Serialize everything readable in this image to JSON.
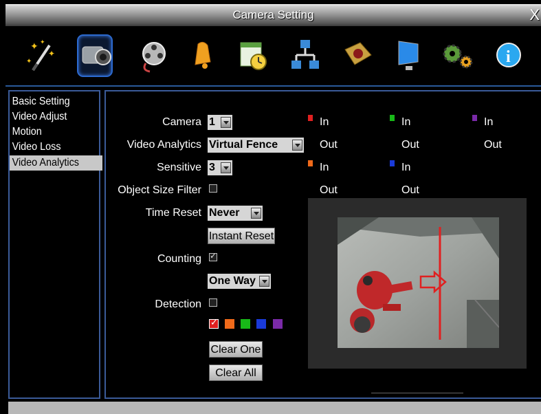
{
  "window": {
    "title": "Camera Setting",
    "close_glyph": "X"
  },
  "toolbar": {
    "icons": [
      {
        "name": "wizard-wand-icon"
      },
      {
        "name": "camera-icon",
        "selected": true
      },
      {
        "name": "video-reel-icon"
      },
      {
        "name": "alarm-bell-icon"
      },
      {
        "name": "schedule-icon"
      },
      {
        "name": "network-icon"
      },
      {
        "name": "hdd-storage-icon"
      },
      {
        "name": "monitor-icon"
      },
      {
        "name": "system-gears-icon"
      },
      {
        "name": "info-icon"
      }
    ]
  },
  "sidebar": {
    "items": [
      {
        "label": "Basic Setting"
      },
      {
        "label": "Video Adjust"
      },
      {
        "label": "Motion"
      },
      {
        "label": "Video Loss"
      },
      {
        "label": "Video Analytics",
        "selected": true
      }
    ]
  },
  "form": {
    "camera_label": "Camera",
    "camera_value": "1",
    "analytics_label": "Video Analytics",
    "analytics_value": "Virtual Fence",
    "sensitive_label": "Sensitive",
    "sensitive_value": "3",
    "object_size_label": "Object Size Filter",
    "object_size_checked": false,
    "time_reset_label": "Time Reset",
    "time_reset_value": "Never",
    "instant_reset_label": "Instant Reset",
    "counting_label": "Counting",
    "counting_checked": true,
    "direction_value": "One Way",
    "detection_label": "Detection",
    "detection_checked": false,
    "clear_one_label": "Clear One",
    "clear_all_label": "Clear All"
  },
  "colors": {
    "line_red": "#e02020",
    "line_orange": "#f06a1a",
    "line_green": "#18b818",
    "line_blue": "#1a3ad8",
    "line_purple": "#7a2aa8",
    "accent_blue": "#3b5b99"
  },
  "counters": [
    {
      "color": "#e02020",
      "in": "In",
      "out": "Out"
    },
    {
      "color": "#18b818",
      "in": "In",
      "out": "Out"
    },
    {
      "color": "#7a2aa8",
      "in": "In",
      "out": "Out"
    },
    {
      "color": "#f06a1a",
      "in": "In",
      "out": "Out"
    },
    {
      "color": "#1a3ad8",
      "in": "In",
      "out": "Out"
    }
  ],
  "line_selector": {
    "selected": "#e02020",
    "swatches": [
      "#e02020",
      "#f06a1a",
      "#18b818",
      "#1a3ad8",
      "#7a2aa8"
    ]
  },
  "preview": {
    "fence_color": "#e02020",
    "direction_arrow": "right"
  }
}
